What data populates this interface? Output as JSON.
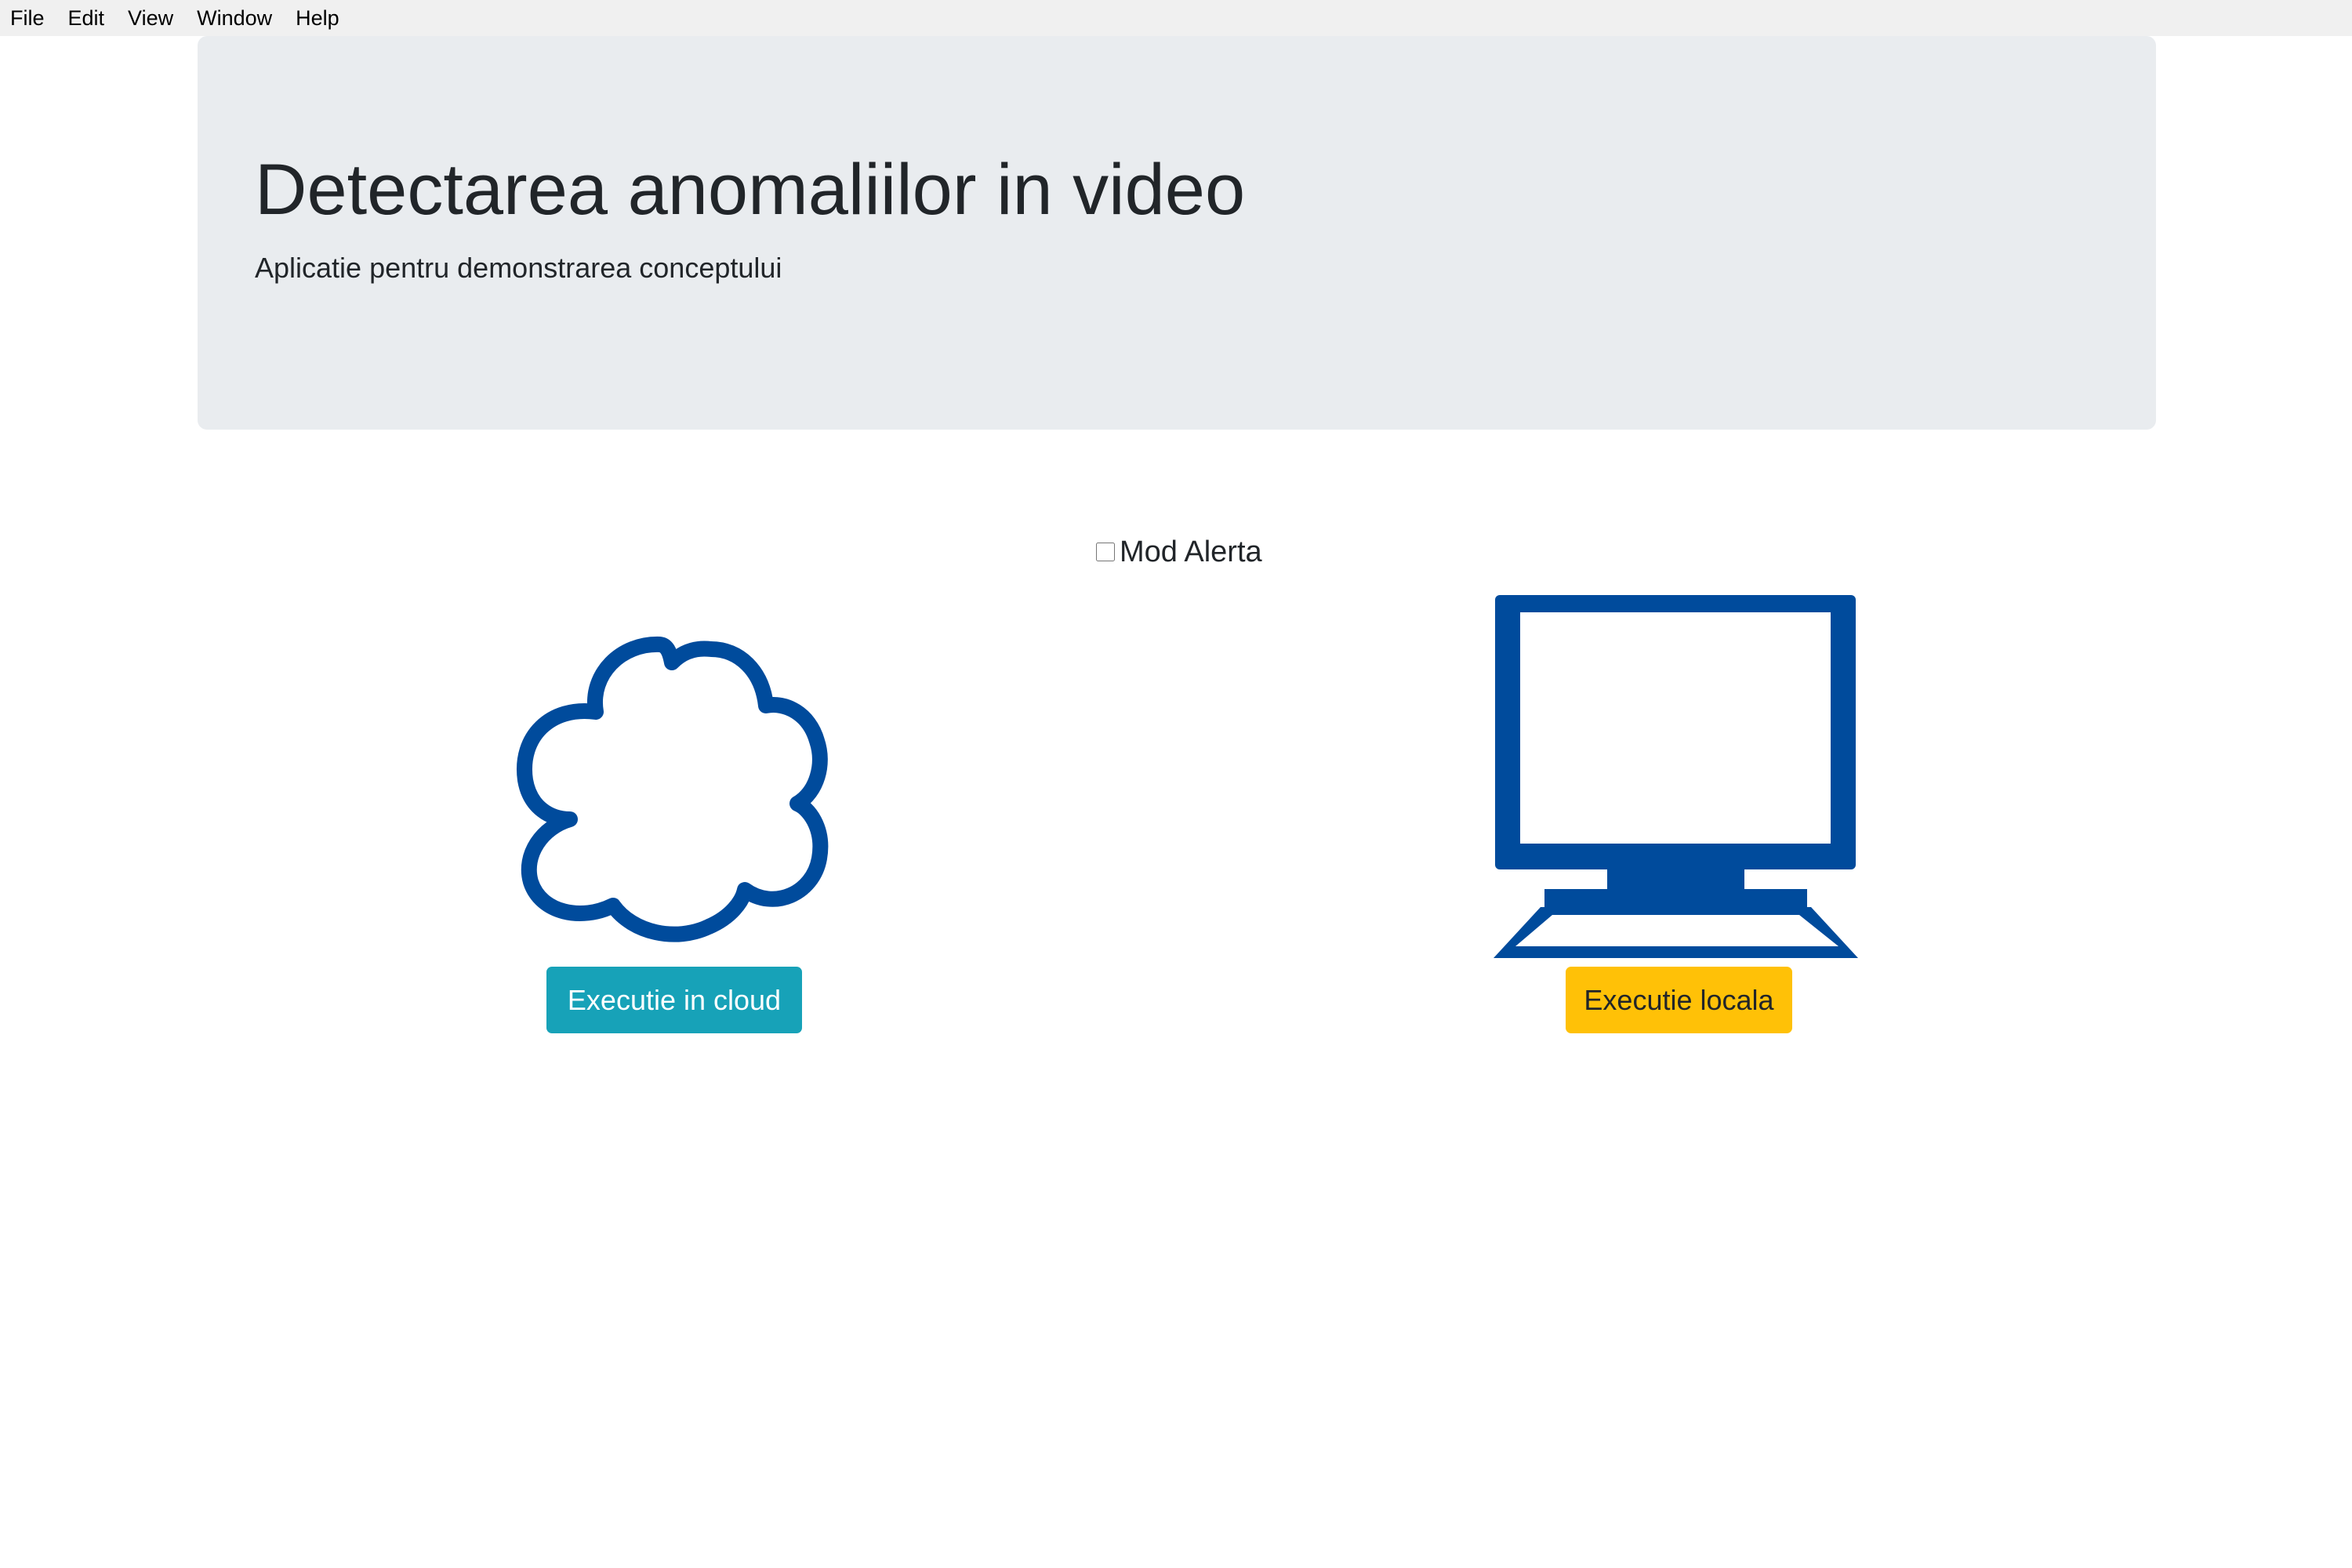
{
  "menubar": {
    "items": [
      {
        "label": "File"
      },
      {
        "label": "Edit"
      },
      {
        "label": "View"
      },
      {
        "label": "Window"
      },
      {
        "label": "Help"
      }
    ]
  },
  "header": {
    "title": "Detectarea anomaliilor in video",
    "subtitle": "Aplicatie pentru demonstrarea conceptului"
  },
  "alert_mode": {
    "label": "Mod Alerta",
    "checked": false
  },
  "options": {
    "cloud": {
      "icon": "cloud-icon",
      "button_label": "Executie in cloud"
    },
    "local": {
      "icon": "computer-icon",
      "button_label": "Executie locala"
    }
  },
  "colors": {
    "jumbotron_bg": "#e9ecef",
    "cloud_button": "#17a2b8",
    "local_button": "#ffc107",
    "icon_blue": "#004b9c"
  }
}
